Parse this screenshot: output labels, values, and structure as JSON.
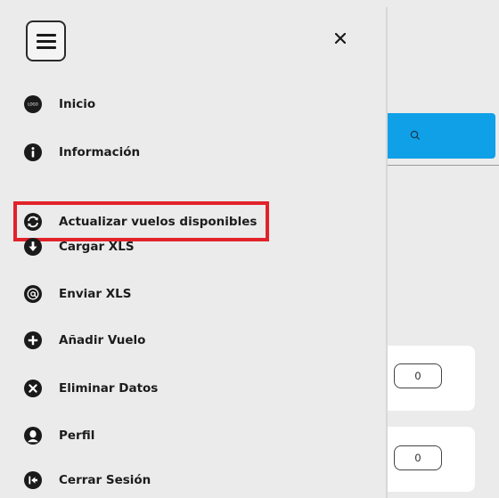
{
  "menu": {
    "items": [
      {
        "label": "Inicio",
        "icon": "logo-icon",
        "logo_text": "LOGO"
      },
      {
        "label": "Información",
        "icon": "info-icon"
      },
      {
        "label": "Actualizar vuelos disponibles",
        "icon": "refresh-icon"
      },
      {
        "label": "Cargar XLS",
        "icon": "download-arrow-icon"
      },
      {
        "label": "Enviar XLS",
        "icon": "at-sign-icon"
      },
      {
        "label": "Añadir Vuelo",
        "icon": "plus-circle-icon"
      },
      {
        "label": "Eliminar Datos",
        "icon": "x-circle-icon"
      },
      {
        "label": "Perfil",
        "icon": "user-icon"
      },
      {
        "label": "Cerrar Sesión",
        "icon": "logout-icon"
      }
    ],
    "highlighted_item": "Actualizar vuelos disponibles"
  },
  "background": {
    "cards": [
      {
        "counter_value": "0"
      },
      {
        "counter_value": "0"
      }
    ]
  },
  "colors": {
    "drawer_bg": "#ebebeb",
    "accent_blue": "#0fa0e8",
    "highlight_red": "#e1222a",
    "icon_dark": "#1a1a1a"
  }
}
